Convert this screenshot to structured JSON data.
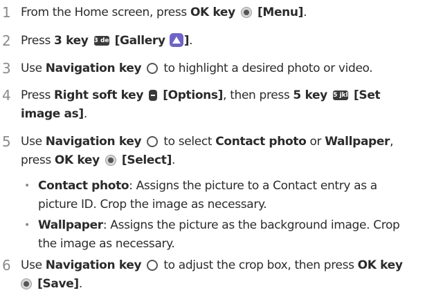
{
  "steps": [
    {
      "n": "1",
      "lines": [
        {
          "t1": "From the Home screen, press ",
          "b1": "OK key",
          "icon": "ok-key-icon",
          "b2": "[Menu]",
          "t2": "."
        }
      ]
    },
    {
      "n": "2",
      "lines": [
        {
          "t1": "Press ",
          "b1": "3 key",
          "key": "3 def",
          "b2": "[Gallery",
          "icon": "gallery-app-icon",
          "b3": "]",
          "t2": "."
        }
      ]
    },
    {
      "n": "3",
      "lines": [
        {
          "t1": "Use ",
          "b1": "Navigation key",
          "icon": "navigation-key-icon",
          "t2": "to highlight a desired photo or video."
        }
      ]
    },
    {
      "n": "4",
      "lines": [
        {
          "t1": "Press ",
          "b1": "Right soft key",
          "icon": "right-soft-key-icon",
          "b2": "[Options]",
          "t2": ", then press ",
          "b3": "5 key",
          "key": "5 jkl",
          "b4": "[Set"
        },
        {
          "b1": "image as]",
          "t2": "."
        }
      ]
    },
    {
      "n": "5",
      "lines": [
        {
          "t1": "Use ",
          "b1": "Navigation key",
          "icon": "navigation-key-icon",
          "t2": "to select ",
          "b2": "Contact photo",
          "t3": " or ",
          "b3": "Wallpaper",
          "t4": ","
        },
        {
          "t1": "press ",
          "b1": "OK key",
          "icon": "ok-key-icon",
          "b2": "[Select]",
          "t2": "."
        }
      ]
    },
    {
      "n": "6",
      "lines": [
        {
          "t1": "Use ",
          "b1": "Navigation key",
          "icon": "navigation-key-icon",
          "t2": "to adjust the crop box, then press ",
          "b2": "OK key"
        },
        {
          "icon": "ok-key-icon",
          "b1": "[Save]",
          "t2": "."
        }
      ]
    }
  ],
  "bullets": [
    {
      "marker": "•",
      "lines": [
        {
          "b1": "Contact photo",
          "t1": ": Assigns the picture to a Contact entry as a"
        },
        {
          "t1": "picture ID. Crop the image as necessary."
        }
      ]
    },
    {
      "marker": "•",
      "lines": [
        {
          "b1": "Wallpaper",
          "t1": ": Assigns the picture as the background image. Crop"
        },
        {
          "t1": "the image as necessary."
        }
      ]
    }
  ]
}
